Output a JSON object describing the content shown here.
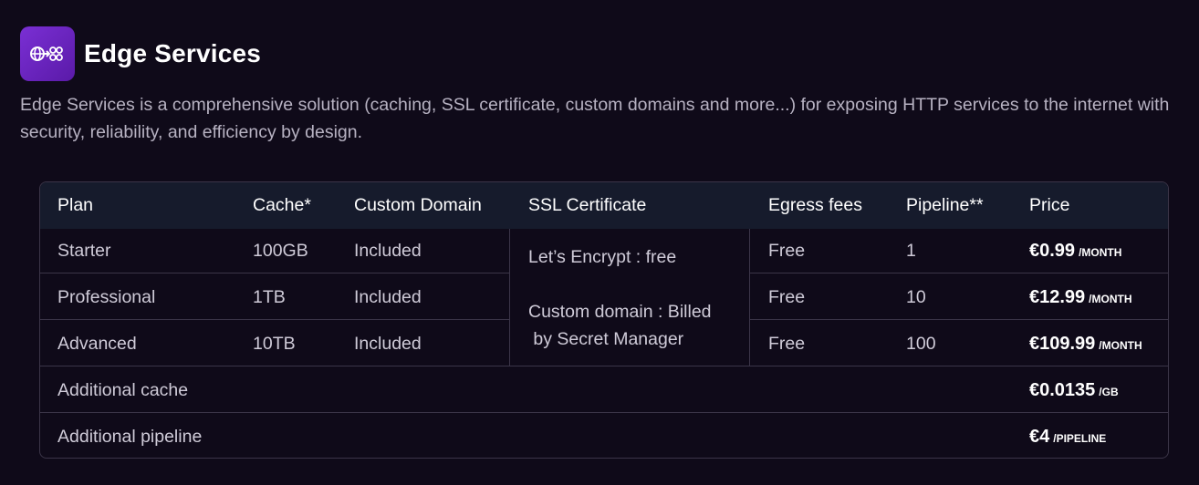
{
  "header": {
    "title": "Edge Services",
    "logo_icon": "globe-arrow-grid-icon",
    "logo_color": "#6b24c2"
  },
  "description": "Edge Services is a comprehensive solution (caching, SSL certificate, custom domains and more...) for exposing HTTP services to the internet with security, reliability, and efficiency by design.",
  "table": {
    "columns": [
      "Plan",
      "Cache*",
      "Custom Domain",
      "SSL Certificate",
      "Egress fees",
      "Pipeline**",
      "Price"
    ],
    "rows": [
      {
        "plan": "Starter",
        "cache": "100GB",
        "domain": "Included",
        "egress": "Free",
        "pipeline": "1",
        "price": "€0.99",
        "unit": "/MONTH"
      },
      {
        "plan": "Professional",
        "cache": "1TB",
        "domain": "Included",
        "egress": "Free",
        "pipeline": "10",
        "price": "€12.99",
        "unit": "/MONTH"
      },
      {
        "plan": "Advanced",
        "cache": "10TB",
        "domain": "Included",
        "egress": "Free",
        "pipeline": "100",
        "price": "€109.99",
        "unit": "/MONTH"
      }
    ],
    "ssl_note": {
      "line1": "Let’s Encrypt : free",
      "line2": "Custom domain : Billed",
      "line3": " by Secret Manager"
    },
    "extras": [
      {
        "label": "Additional cache",
        "price": "€0.0135",
        "unit": "/GB"
      },
      {
        "label": "Additional pipeline",
        "price": "€4",
        "unit": "/PIPELINE"
      }
    ]
  }
}
